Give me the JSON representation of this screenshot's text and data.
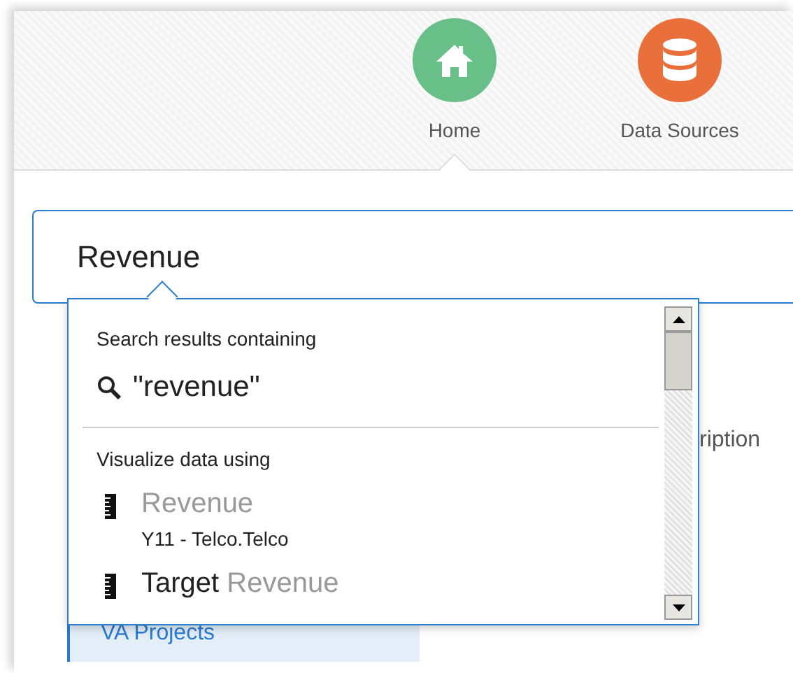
{
  "nav": [
    {
      "label": "Home",
      "color": "#68bf88",
      "selected": true
    },
    {
      "label": "Data Sources",
      "color": "#e96f3b",
      "selected": false
    }
  ],
  "search": {
    "value": "Revenue"
  },
  "table": {
    "columns": [
      "ription"
    ]
  },
  "sidebar": {
    "items": [
      {
        "label": "VA Projects",
        "selected": true
      }
    ]
  },
  "dropdown": {
    "search_heading": "Search results containing",
    "search_term": "\"revenue\"",
    "section_heading": "Visualize data using",
    "results": [
      {
        "parts": [
          {
            "text": "Revenue",
            "match": true
          }
        ],
        "subtitle": "Y11 - Telco.Telco"
      },
      {
        "parts": [
          {
            "text": "Target",
            "match": false
          },
          {
            "text": "Revenue",
            "match": true
          }
        ]
      }
    ]
  }
}
